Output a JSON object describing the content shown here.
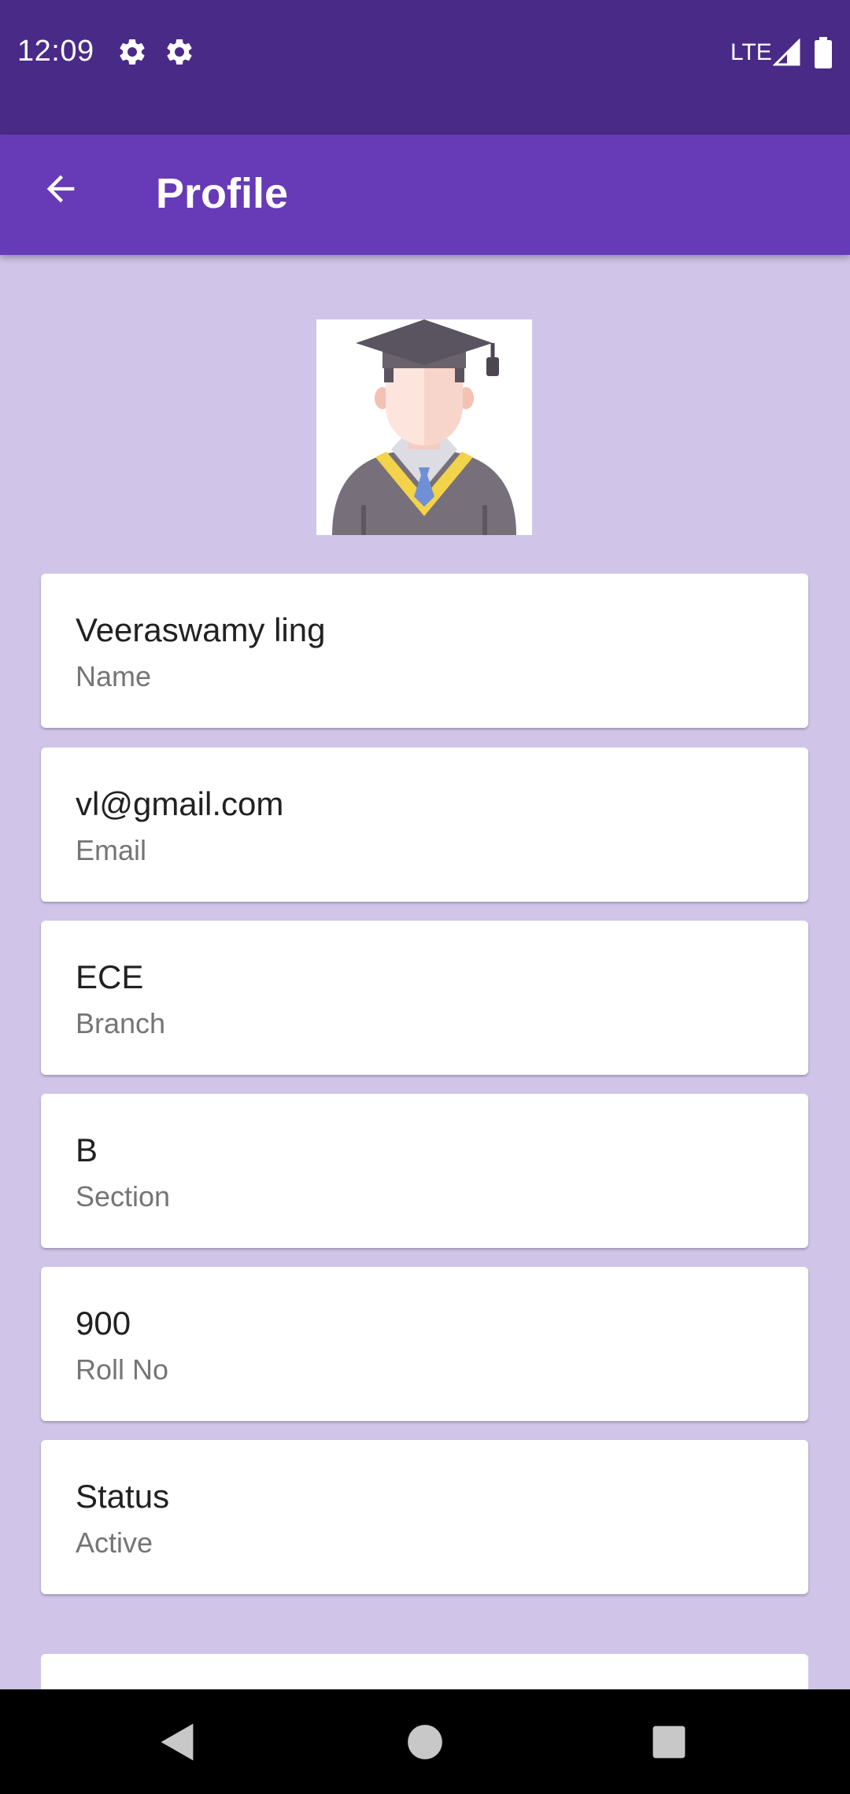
{
  "status_bar": {
    "time": "12:09",
    "network": "LTE",
    "icons": [
      "gear-icon",
      "gear-icon",
      "signal-icon",
      "battery-icon"
    ]
  },
  "app_bar": {
    "title": "Profile",
    "back_icon": "arrow-back-icon"
  },
  "profile": {
    "avatar_icon": "graduate-avatar",
    "fields": [
      {
        "value": "Veeraswamy ling",
        "label": "Name"
      },
      {
        "value": "vl@gmail.com",
        "label": "Email"
      },
      {
        "value": "ECE",
        "label": "Branch"
      },
      {
        "value": "B",
        "label": "Section"
      },
      {
        "value": "900",
        "label": "Roll No"
      },
      {
        "value": "Status",
        "label": "Active"
      }
    ]
  },
  "nav_bar": {
    "buttons": [
      "back-triangle-icon",
      "home-circle-icon",
      "recents-square-icon"
    ]
  },
  "colors": {
    "status_bar": "#4a2a87",
    "app_bar": "#673ab7",
    "background": "#d1c4e9",
    "card": "#ffffff"
  }
}
